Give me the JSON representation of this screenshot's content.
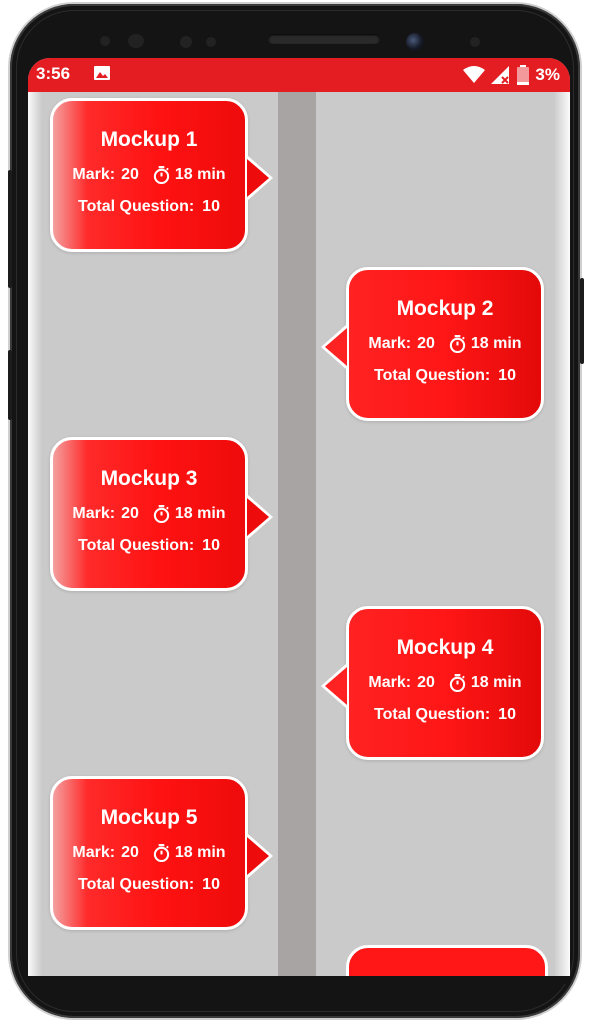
{
  "status_bar": {
    "time": "3:56",
    "battery_percent": "3%",
    "icons": [
      "image-notification-icon",
      "wifi-icon",
      "signal-no-service-icon",
      "battery-icon"
    ]
  },
  "colors": {
    "accent": "#e41d22",
    "card": "#ff1616",
    "timeline": "#a8a4a4",
    "background": "#cacaca"
  },
  "mockups": [
    {
      "title": "Mockup 1",
      "mark_label": "Mark:",
      "mark_value": "20",
      "duration": "18 min",
      "total_label": "Total Question:",
      "total_value": "10",
      "side": "left"
    },
    {
      "title": "Mockup 2",
      "mark_label": "Mark:",
      "mark_value": "20",
      "duration": "18 min",
      "total_label": "Total Question:",
      "total_value": "10",
      "side": "right"
    },
    {
      "title": "Mockup 3",
      "mark_label": "Mark:",
      "mark_value": "20",
      "duration": "18 min",
      "total_label": "Total Question:",
      "total_value": "10",
      "side": "left"
    },
    {
      "title": "Mockup 4",
      "mark_label": "Mark:",
      "mark_value": "20",
      "duration": "18 min",
      "total_label": "Total Question:",
      "total_value": "10",
      "side": "right"
    },
    {
      "title": "Mockup 5",
      "mark_label": "Mark:",
      "mark_value": "20",
      "duration": "18 min",
      "total_label": "Total Question:",
      "total_value": "10",
      "side": "left"
    }
  ]
}
